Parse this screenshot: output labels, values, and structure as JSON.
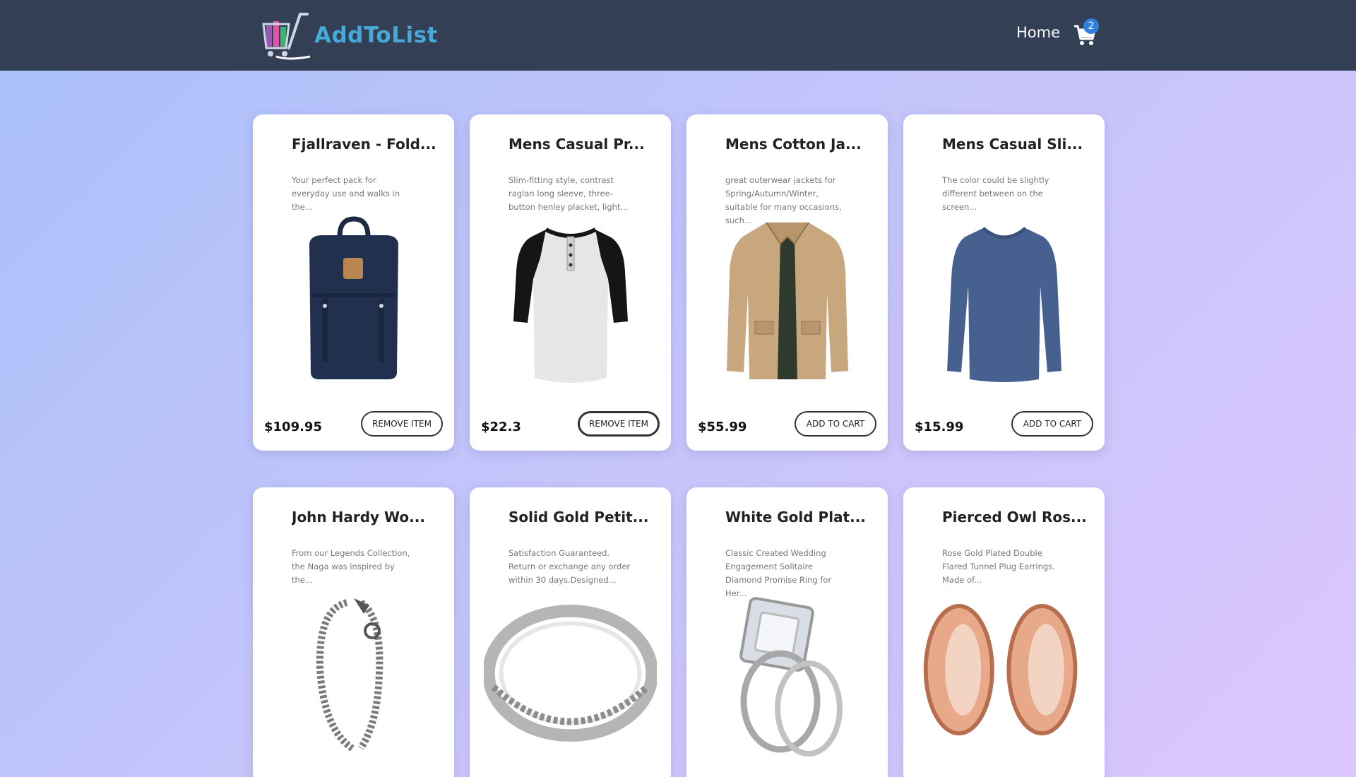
{
  "header": {
    "brand": "AddToList",
    "nav_home": "Home",
    "cart_count": "2"
  },
  "products_row1": [
    {
      "title": "Fjallraven - Fold...",
      "description": "Your perfect pack for everyday use and walks in the...",
      "price": "$109.95",
      "button": "REMOVE ITEM",
      "image": "navy-backpack"
    },
    {
      "title": "Mens Casual Pr...",
      "description": "Slim-fitting style, contrast raglan long sleeve, three-button henley placket, light...",
      "price": "$22.3",
      "button": "REMOVE ITEM",
      "image": "raglan-henley-shirt"
    },
    {
      "title": "Mens Cotton Ja...",
      "description": "great outerwear jackets for Spring/Autumn/Winter, suitable for many occasions, such...",
      "price": "$55.99",
      "button": "ADD TO CART",
      "image": "tan-cotton-jacket"
    },
    {
      "title": "Mens Casual Sli...",
      "description": "The color could be slightly different between on the screen...",
      "price": "$15.99",
      "button": "ADD TO CART",
      "image": "blue-long-sleeve-tee"
    }
  ],
  "products_row2": [
    {
      "title": "John Hardy Wo...",
      "description": "From our Legends Collection, the Naga was inspired by the...",
      "image": "dragon-chain-bracelet"
    },
    {
      "title": "Solid Gold Petit...",
      "description": "Satisfaction Guaranteed. Return or exchange any order within 30 days.Designed...",
      "image": "silver-band-ring"
    },
    {
      "title": "White Gold Plat...",
      "description": "Classic Created Wedding Engagement Solitaire Diamond Promise Ring for Her...",
      "image": "diamond-ring-set"
    },
    {
      "title": "Pierced Owl Ros...",
      "description": "Rose Gold Plated Double Flared Tunnel Plug Earrings. Made of...",
      "image": "rose-gold-plugs"
    }
  ],
  "colors": {
    "navbar": "#333f55",
    "brand": "#46a9d8",
    "badge": "#2f7fe0"
  }
}
